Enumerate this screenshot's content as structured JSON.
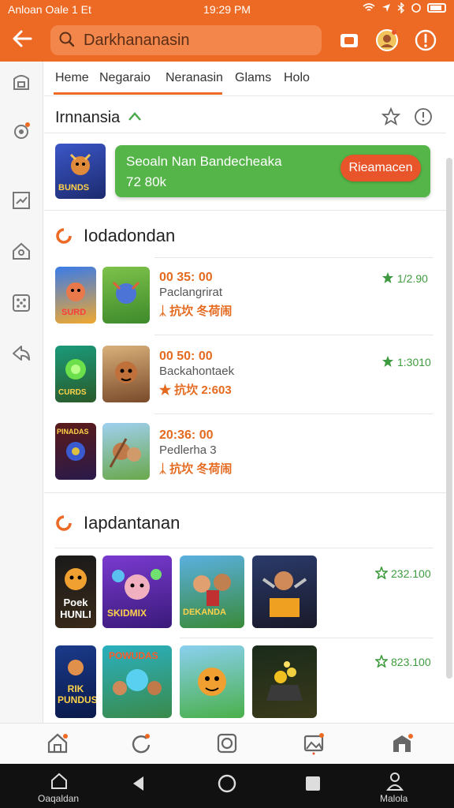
{
  "status": {
    "left": "Anloan Oale  1 Et",
    "time": "19:29 PM"
  },
  "search": {
    "value": "Darkhananasin"
  },
  "tabs": [
    "Heme",
    "Negaraio",
    "Neranasin",
    "Glams",
    "Holo"
  ],
  "featured": {
    "title": "Irnnansia",
    "promo_title": "Seoaln Nan Bandecheaka",
    "promo_sub": "72 80k",
    "promo_button": "Rieamacen",
    "thumb_text": "BUNDS"
  },
  "section1": {
    "title": "Iodadondan",
    "items": [
      {
        "time": "00 35: 00",
        "sub": "Paclangrirat",
        "tag": "ᛣ 抗坎 冬荷闹",
        "rating": "1/2.90",
        "thumb1": "SURD",
        "thumb2": ""
      },
      {
        "time": "00 50: 00",
        "sub": "Backahontaek",
        "tag": "★ 抗坎 2:603",
        "rating": "1:3010",
        "thumb1": "CURDS",
        "thumb2": ""
      },
      {
        "time": "20:36: 00",
        "sub": "Pedlerha 3",
        "tag": "ᛣ 抗坎 冬荷闹",
        "rating": "",
        "thumb1": "PINADAS",
        "thumb2": ""
      }
    ]
  },
  "section2": {
    "title": "Iapdantanan",
    "rows": [
      {
        "rating": "232.100",
        "thumbs": [
          "Poek HUNLI",
          "SKIDMIX",
          "DEKANDA",
          ""
        ]
      },
      {
        "rating": "823.100",
        "thumbs": [
          "RIK PUNDUS",
          "POWUDAS",
          "",
          ""
        ]
      }
    ]
  },
  "sysnav": {
    "left_label": "Oaqaldan",
    "right_label": "Malola"
  },
  "colors": {
    "accent": "#ec6a24",
    "green": "#55b548",
    "promo_button": "#e8552a"
  }
}
